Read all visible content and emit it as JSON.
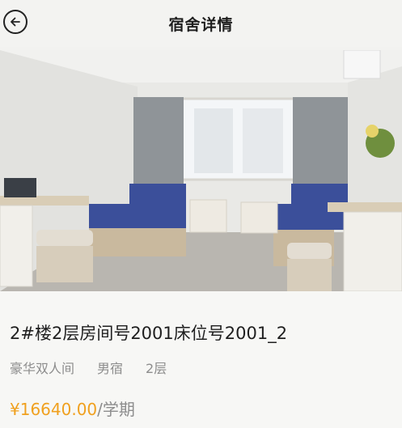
{
  "header": {
    "title": "宿舍详情",
    "back_icon": "arrow-left-icon"
  },
  "photo": {
    "subject": "dormitory room photo"
  },
  "room": {
    "title": "2#楼2层房间号2001床位号2001_2",
    "tags": [
      "豪华双人间",
      "男宿",
      "2层"
    ],
    "price": "¥16640.00",
    "price_unit": "/学期"
  },
  "colors": {
    "price": "#f0a01e",
    "muted": "#8d8d8d",
    "title": "#1f1f1f"
  }
}
